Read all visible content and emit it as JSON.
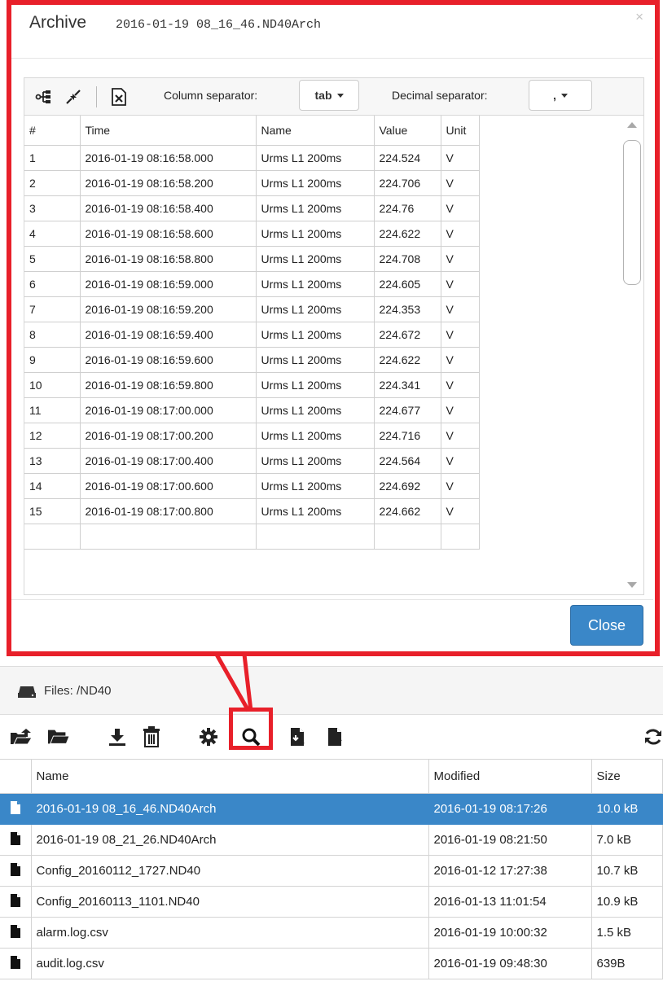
{
  "modal": {
    "title": "Archive",
    "filename": "2016-01-19 08_16_46.ND40Arch",
    "close_x": "×",
    "toolbar": {
      "icons": [
        "tree-icon",
        "collapse-icon",
        "excel-export-icon"
      ],
      "column_separator_label": "Column separator:",
      "column_separator_value": "tab",
      "decimal_separator_label": "Decimal separator:",
      "decimal_separator_value": ","
    },
    "table": {
      "columns": [
        "#",
        "Time",
        "Name",
        "Value",
        "Unit"
      ],
      "rows": [
        [
          "1",
          "2016-01-19 08:16:58.000",
          "Urms L1 200ms",
          "224.524",
          "V"
        ],
        [
          "2",
          "2016-01-19 08:16:58.200",
          "Urms L1 200ms",
          "224.706",
          "V"
        ],
        [
          "3",
          "2016-01-19 08:16:58.400",
          "Urms L1 200ms",
          "224.76",
          "V"
        ],
        [
          "4",
          "2016-01-19 08:16:58.600",
          "Urms L1 200ms",
          "224.622",
          "V"
        ],
        [
          "5",
          "2016-01-19 08:16:58.800",
          "Urms L1 200ms",
          "224.708",
          "V"
        ],
        [
          "6",
          "2016-01-19 08:16:59.000",
          "Urms L1 200ms",
          "224.605",
          "V"
        ],
        [
          "7",
          "2016-01-19 08:16:59.200",
          "Urms L1 200ms",
          "224.353",
          "V"
        ],
        [
          "8",
          "2016-01-19 08:16:59.400",
          "Urms L1 200ms",
          "224.672",
          "V"
        ],
        [
          "9",
          "2016-01-19 08:16:59.600",
          "Urms L1 200ms",
          "224.622",
          "V"
        ],
        [
          "10",
          "2016-01-19 08:16:59.800",
          "Urms L1 200ms",
          "224.341",
          "V"
        ],
        [
          "11",
          "2016-01-19 08:17:00.000",
          "Urms L1 200ms",
          "224.677",
          "V"
        ],
        [
          "12",
          "2016-01-19 08:17:00.200",
          "Urms L1 200ms",
          "224.716",
          "V"
        ],
        [
          "13",
          "2016-01-19 08:17:00.400",
          "Urms L1 200ms",
          "224.564",
          "V"
        ],
        [
          "14",
          "2016-01-19 08:17:00.600",
          "Urms L1 200ms",
          "224.692",
          "V"
        ],
        [
          "15",
          "2016-01-19 08:17:00.800",
          "Urms L1 200ms",
          "224.662",
          "V"
        ]
      ]
    },
    "close_button": "Close"
  },
  "files": {
    "title": "Files: /ND40",
    "toolbar_icons": [
      "open-folder-up-icon",
      "folder-icon",
      "download-icon",
      "trash-icon",
      "gear-icon",
      "search-icon",
      "file-import-icon",
      "file-export-icon",
      "refresh-icon"
    ],
    "table": {
      "columns": [
        "",
        "Name",
        "Modified",
        "Size"
      ],
      "rows": [
        {
          "name": "2016-01-19 08_16_46.ND40Arch",
          "modified": "2016-01-19 08:17:26",
          "size": "10.0 kB",
          "selected": true
        },
        {
          "name": "2016-01-19 08_21_26.ND40Arch",
          "modified": "2016-01-19 08:21:50",
          "size": "7.0 kB",
          "selected": false
        },
        {
          "name": "Config_20160112_1727.ND40",
          "modified": "2016-01-12 17:27:38",
          "size": "10.7 kB",
          "selected": false
        },
        {
          "name": "Config_20160113_1101.ND40",
          "modified": "2016-01-13 11:01:54",
          "size": "10.9 kB",
          "selected": false
        },
        {
          "name": "alarm.log.csv",
          "modified": "2016-01-19 10:00:32",
          "size": "1.5 kB",
          "selected": false
        },
        {
          "name": "audit.log.csv",
          "modified": "2016-01-19 09:48:30",
          "size": "639B",
          "selected": false
        }
      ]
    }
  },
  "colors": {
    "highlight": "#e8202a",
    "selected_row": "#3a87c8",
    "primary_button": "#3a87c8"
  }
}
